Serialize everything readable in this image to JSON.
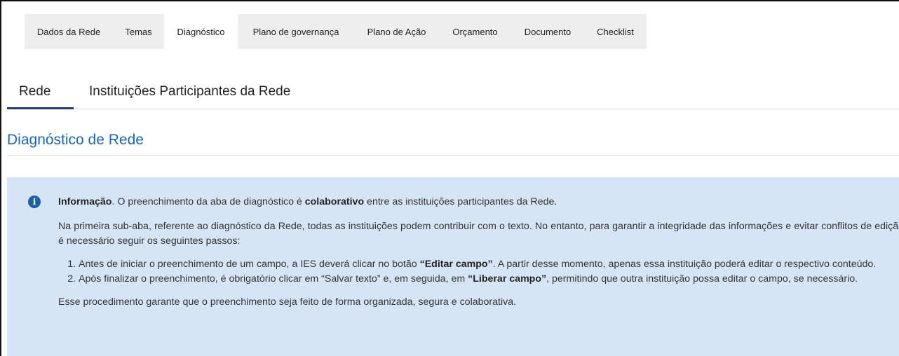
{
  "top_tabs": [
    {
      "label": "Dados da Rede",
      "active": false
    },
    {
      "label": "Temas",
      "active": false
    },
    {
      "label": "Diagnóstico",
      "active": true
    },
    {
      "label": "Plano de governança",
      "active": false
    },
    {
      "label": "Plano de Ação",
      "active": false
    },
    {
      "label": "Orçamento",
      "active": false
    },
    {
      "label": "Documento",
      "active": false
    },
    {
      "label": "Checklist",
      "active": false
    }
  ],
  "sub_tabs": [
    {
      "label": "Rede",
      "active": true
    },
    {
      "label": "Instituições Participantes da Rede",
      "active": false
    }
  ],
  "section_title": "Diagnóstico de Rede",
  "info": {
    "icon": "info-icon",
    "bold_intro": "Informação",
    "intro_rest_a": ". O preenchimento da aba de diagnóstico é ",
    "intro_bold": "colaborativo",
    "intro_rest_b": " entre as instituições participantes da Rede.",
    "paragraph2": "Na primeira sub-aba, referente ao diagnóstico da Rede, todas as instituições podem contribuir com o texto. No entanto, para garantir a integridade das informações e evitar conflitos de edição, é necessário seguir os seguintes passos:",
    "step1_a": "Antes de iniciar o preenchimento de um campo, a IES deverá clicar no botão ",
    "step1_bold": "“Editar campo”",
    "step1_b": ". A partir desse momento, apenas essa instituição poderá editar o respectivo conteúdo.",
    "step2_a": "Após finalizar o preenchimento, é obrigatório clicar em “Salvar texto” e, em seguida, em ",
    "step2_bold": "“Liberar campo”",
    "step2_b": ", permitindo que outra instituição possa editar o campo, se necessário.",
    "closing": "Esse procedimento garante que o preenchimento seja feito de forma organizada, segura e colaborativa."
  },
  "colors": {
    "accent": "#1a3c78",
    "heading": "#2166b0",
    "info_bg": "#d5e5f7",
    "tab_bg": "#eeeeee"
  }
}
